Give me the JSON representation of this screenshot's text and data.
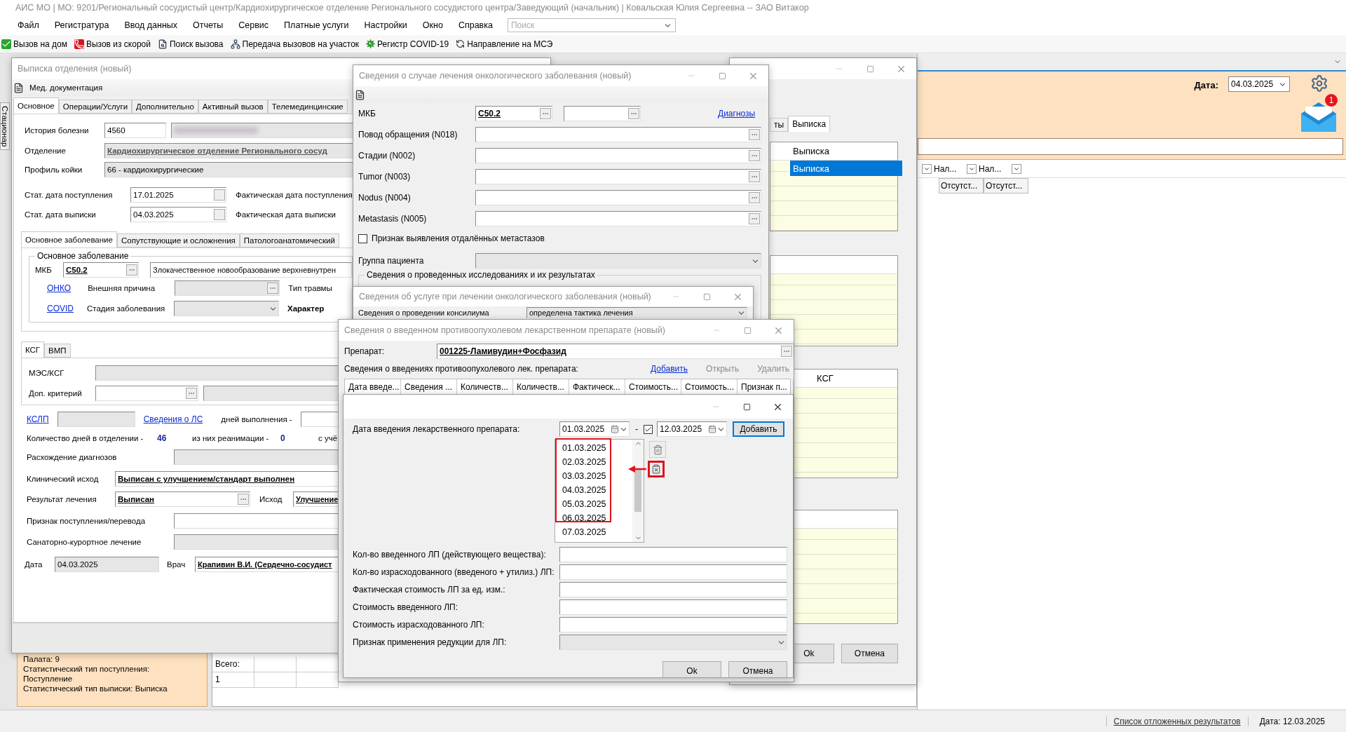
{
  "app": {
    "title": "АИС МО | МО: 9201/Региональный сосудистый центр/Кардиохирургическое отделение Регионального сосудистого центра/Заведующий (начальник) | Ковальская Юлия Сергеевна -- ЗАО Витакор"
  },
  "menu": [
    "Файл",
    "Регистратура",
    "Ввод данных",
    "Отчеты",
    "Сервис",
    "Платные услуги",
    "Настройки",
    "Окно",
    "Справка"
  ],
  "search": {
    "placeholder": "Поиск"
  },
  "toolbar": [
    {
      "kind": "home",
      "label": "Вызов на дом"
    },
    {
      "kind": "ambulance",
      "label": "Вызов из скорой"
    },
    {
      "kind": "search",
      "label": "Поиск вызова"
    },
    {
      "kind": "transfer",
      "label": "Передача вызовов на участок"
    },
    {
      "kind": "covid",
      "label": "Регистр COVID-19"
    },
    {
      "kind": "mse",
      "label": "Направление на МСЭ"
    }
  ],
  "side_tab": "Стационар",
  "right_panel": {
    "date_label": "Дата:",
    "date": "04.03.2025",
    "mail_count": "1",
    "columns": [
      "Нал...",
      "Нал..."
    ],
    "cells": [
      "Отсутст...",
      "Отсутст..."
    ]
  },
  "info_panel": [
    "Палата: 9",
    "Статистический тип поступления:",
    "Поступление",
    "Статистический тип выписки: Выписка"
  ],
  "totals": {
    "label": "Всего:",
    "value": "1"
  },
  "status_bar": {
    "link": "Список отложенных результатов",
    "date": "Дата: 12.03.2025"
  },
  "discharge": {
    "title": "Выписка отделения (новый)",
    "doc_menu": "Мед. документация",
    "tabs": [
      {
        "label": "Основное",
        "selected": true
      },
      {
        "label": "Операции/Услуги",
        "selected": false
      },
      {
        "label": "Дополнительно",
        "selected": false
      },
      {
        "label": "Активный вызов",
        "selected": false
      },
      {
        "label": "Телемединцинские",
        "selected": false
      }
    ],
    "history": {
      "label": "История болезни",
      "value": "4560"
    },
    "department": {
      "label": "Отделение",
      "value": "Кардиохирургическое отделение Регионального сосуд"
    },
    "bed_profile": {
      "label": "Профиль койки",
      "value": "66 - кардиохирургические"
    },
    "admission": {
      "label": "Стат. дата поступления",
      "value": "17.01.2025",
      "actual_label": "Фактическая дата поступления"
    },
    "discharge_date": {
      "label": "Стат. дата выписки",
      "value": "04.03.2025",
      "actual_label": "Фактическая дата выписки"
    },
    "disease_tabs": [
      {
        "label": "Основное заболевание",
        "selected": true
      },
      {
        "label": "Сопутствующие и осложнения",
        "selected": false
      },
      {
        "label": "Патологоанатомический",
        "selected": false
      }
    ],
    "group_title": "Основное заболевание",
    "mkb": {
      "label": "МКБ",
      "value": "C50.2",
      "description": "Злокачественное новообразование верхневнутрен"
    },
    "onko_link": "ОНКО",
    "external_cause": "Внешняя причина",
    "injury_type": "Тип травмы",
    "covid_link": "COVID",
    "stage": "Стадия заболевания",
    "character": "Характер",
    "ksg_tabs": [
      {
        "label": "КСГ",
        "selected": true
      },
      {
        "label": "ВМП",
        "selected": false
      }
    ],
    "mes_label": "МЭС/КСГ",
    "extra_label": "Доп. критерий",
    "kslp_link": "КСЛП",
    "ls_link": "Сведения о ЛС",
    "exec_days": "дней выполнения -",
    "days": {
      "label": "Количество дней в отделении -",
      "value": "46",
      "reanim_label": "из них реанимации -",
      "reanim_value": "0",
      "extra": "с учё"
    },
    "divergence": "Расхождение диагнозов",
    "outcome": {
      "label": "Клинический исход",
      "value": "Выписан с улучшением/стандарт выполнен"
    },
    "result": {
      "label": "Результат лечения",
      "value": "Выписан",
      "outcome_label": "Исход",
      "outcome_value": "Улучшение"
    },
    "transfer_sign": "Признак поступления/перевода",
    "sanatorium": "Санаторно-курортное лечение",
    "date": {
      "label": "Дата",
      "value": "04.03.2025"
    },
    "doctor": {
      "label": "Врач",
      "value": "Крапивин В.И. (Сердечно-сосудист"
    }
  },
  "back_window": {
    "tabs": [
      {
        "label": "ты",
        "selected": false
      },
      {
        "label": "Выписка",
        "selected": true
      }
    ],
    "grid_header": "Выписка",
    "rows": [
      {
        "cell": "Выписка",
        "selected": true
      }
    ],
    "grid3_header": "КСГ",
    "buttons": [
      "Ok",
      "Отмена"
    ]
  },
  "onco": {
    "title": "Сведения о случае лечения онкологического заболевания (новый)",
    "mkb": {
      "label": "МКБ",
      "value": "C50.2"
    },
    "diagnoses_link": "Диагнозы",
    "fields": [
      "Повод обращения (N018)",
      "Стадии (N002)",
      "Tumor (N003)",
      "Nodus (N004)",
      "Metastasis (N005)"
    ],
    "checkbox": {
      "label": "Признак выявления отдалённых метастазов",
      "checked": false
    },
    "group_label": "Группа пациента",
    "section_title": "Сведения о проведенных исследованиях и их результатах"
  },
  "service": {
    "title": "Сведения об услуге при лечении онкологического заболевания (новый)",
    "council_label": "Сведения о проведении консилиума",
    "council_value": "определена тактика лечения"
  },
  "drug": {
    "title": "Сведения о введенном противоопухолевом лекарственном препарате (новый)",
    "drug_label": "Препарат:",
    "drug_value": "001225-Ламивудин+Фосфазид",
    "section_label": "Сведения о введениях противоопухолевого лек. препарата:",
    "actions": [
      {
        "label": "Добавить",
        "disabled": false
      },
      {
        "label": "Открыть",
        "disabled": true
      },
      {
        "label": "Удалить",
        "disabled": true
      }
    ],
    "columns": [
      "Дата введе...",
      "Сведения ...",
      "Количеств...",
      "Количеств...",
      "Фактическ...",
      "Стоимость...",
      "Стоимость...",
      "Признак п..."
    ]
  },
  "dates_dialog": {
    "date_label": "Дата введения лекарственного препарата:",
    "from": "01.03.2025",
    "separator": "-",
    "range_checked": true,
    "to": "12.03.2025",
    "add_button": "Добавить",
    "dates": [
      "01.03.2025",
      "02.03.2025",
      "03.03.2025",
      "04.03.2025",
      "05.03.2025",
      "06.03.2025",
      "07.03.2025"
    ],
    "fields": [
      {
        "kind": "input",
        "label": "Кол-во введенного ЛП (действующего вещества):"
      },
      {
        "kind": "input",
        "label": "Кол-во израсходованного (введеного + утилиз.) ЛП:"
      },
      {
        "kind": "input",
        "label": "Фактическая стоимость ЛП за ед. изм.:"
      },
      {
        "kind": "input",
        "label": "Стоимость введенного ЛП:"
      },
      {
        "kind": "input",
        "label": "Стоимость израсходованного ЛП:"
      },
      {
        "kind": "select",
        "label": "Признак применения редукции для ЛП:"
      }
    ],
    "buttons": [
      "Ok",
      "Отмена"
    ]
  }
}
